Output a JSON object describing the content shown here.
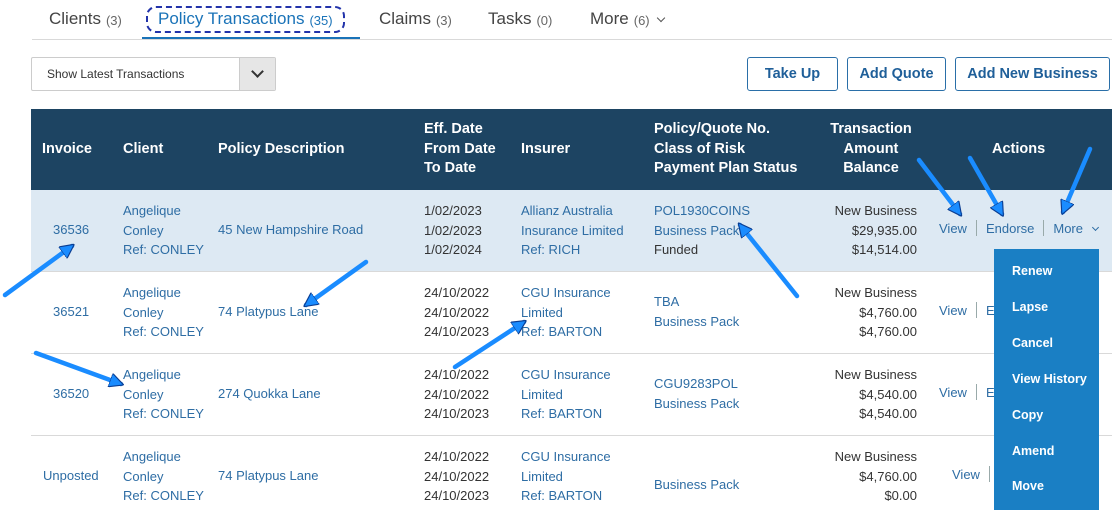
{
  "tabs": [
    {
      "label": "Clients",
      "count": "(3)"
    },
    {
      "label": "Policy Transactions",
      "count": "(35)"
    },
    {
      "label": "Claims",
      "count": "(3)"
    },
    {
      "label": "Tasks",
      "count": "(0)"
    },
    {
      "label": "More",
      "count": "(6)"
    }
  ],
  "toolbar": {
    "filter_value": "Show Latest Transactions",
    "take_up": "Take Up",
    "add_quote": "Add Quote",
    "add_new_business": "Add New Business"
  },
  "table": {
    "headers": {
      "invoice": "Invoice",
      "client": "Client",
      "policy_description": "Policy Description",
      "dates": [
        "Eff. Date",
        "From Date",
        "To Date"
      ],
      "insurer": "Insurer",
      "policy": [
        "Policy/Quote No.",
        "Class of Risk",
        "Payment Plan Status"
      ],
      "amount": [
        "Transaction",
        "Amount",
        "Balance"
      ],
      "actions": "Actions"
    },
    "rows": [
      {
        "invoice": "36536",
        "client": [
          "Angelique",
          "Conley",
          "Ref: CONLEY"
        ],
        "description": "45 New Hampshire Road",
        "dates": [
          "1/02/2023",
          "1/02/2023",
          "1/02/2024"
        ],
        "insurer": [
          "Allianz Australia",
          "Insurance Limited",
          "Ref: RICH"
        ],
        "policy": [
          "POL1930COINS",
          "Business Pack",
          "Funded"
        ],
        "amount": [
          "New Business",
          "$29,935.00",
          "$14,514.00"
        ],
        "actions": [
          "View",
          "Endorse",
          "More"
        ]
      },
      {
        "invoice": "36521",
        "client": [
          "Angelique",
          "Conley",
          "Ref: CONLEY"
        ],
        "description": "74 Platypus Lane",
        "dates": [
          "24/10/2022",
          "24/10/2022",
          "24/10/2023"
        ],
        "insurer": [
          "CGU Insurance",
          "Limited",
          "Ref: BARTON"
        ],
        "policy": [
          "TBA",
          "Business Pack",
          ""
        ],
        "amount": [
          "New Business",
          "$4,760.00",
          "$4,760.00"
        ],
        "actions": [
          "View",
          "E"
        ]
      },
      {
        "invoice": "36520",
        "client": [
          "Angelique",
          "Conley",
          "Ref: CONLEY"
        ],
        "description": "274 Quokka Lane",
        "dates": [
          "24/10/2022",
          "24/10/2022",
          "24/10/2023"
        ],
        "insurer": [
          "CGU Insurance",
          "Limited",
          "Ref: BARTON"
        ],
        "policy": [
          "CGU9283POL",
          "Business Pack",
          ""
        ],
        "amount": [
          "New Business",
          "$4,540.00",
          "$4,540.00"
        ],
        "actions": [
          "View",
          "E"
        ]
      },
      {
        "invoice": "Unposted",
        "client": [
          "Angelique",
          "Conley",
          "Ref: CONLEY"
        ],
        "description": "74 Platypus Lane",
        "dates": [
          "24/10/2022",
          "24/10/2022",
          "24/10/2023"
        ],
        "insurer": [
          "CGU Insurance",
          "Limited",
          "Ref: BARTON"
        ],
        "policy": [
          "",
          "Business Pack",
          ""
        ],
        "amount": [
          "New Business",
          "$4,760.00",
          "$0.00"
        ],
        "actions": [
          "View",
          ""
        ]
      }
    ]
  },
  "more_menu": [
    "Renew",
    "Lapse",
    "Cancel",
    "View History",
    "Copy",
    "Amend",
    "Move"
  ],
  "colors": {
    "header_bg": "#1d4462",
    "highlight_row": "#dde9f3",
    "link": "#2e6da4",
    "menu_bg": "#1a7fc4",
    "annotation_arrow": "#1a8cff"
  }
}
